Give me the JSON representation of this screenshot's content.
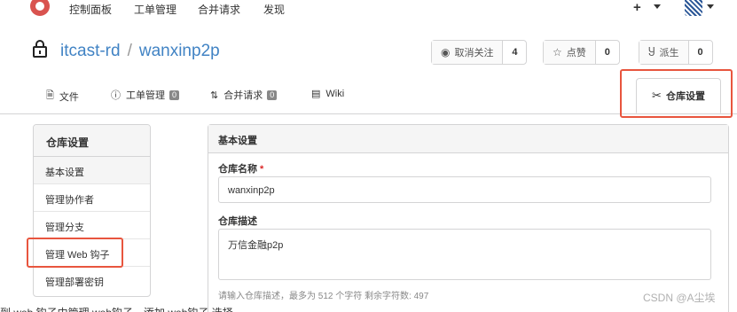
{
  "topnav": {
    "items": [
      "控制面板",
      "工单管理",
      "合并请求",
      "发现"
    ],
    "plus": "+"
  },
  "repo": {
    "owner": "itcast-rd",
    "separator": "/",
    "name": "wanxinp2p"
  },
  "actions": {
    "unwatch_label": "取消关注",
    "unwatch_count": "4",
    "star_label": "点赞",
    "star_count": "0",
    "fork_label": "派生",
    "fork_count": "0"
  },
  "tabs": {
    "files": "文件",
    "issues": "工单管理",
    "issues_count": "0",
    "pulls": "合并请求",
    "pulls_count": "0",
    "wiki": "Wiki",
    "settings": "仓库设置"
  },
  "sidebar": {
    "title": "仓库设置",
    "items": [
      "基本设置",
      "管理协作者",
      "管理分支",
      "管理 Web 钩子",
      "管理部署密钥"
    ]
  },
  "main": {
    "header": "基本设置",
    "repo_name_label": "仓库名称",
    "repo_name_required": "*",
    "repo_name_value": "wanxinp2p",
    "desc_label": "仓库描述",
    "desc_value": "万信金融p2p",
    "help_text": "请输入仓库描述，最多为 512 个字符 剩余字符数: 497"
  },
  "watermark": "CSDN @A尘埃",
  "bottom_text": "到 web 钩子中管理 web钩子，添加 web钩子 选择",
  "colors": {
    "link": "#4183c4",
    "highlight": "#e8553e",
    "required": "#db2828"
  }
}
